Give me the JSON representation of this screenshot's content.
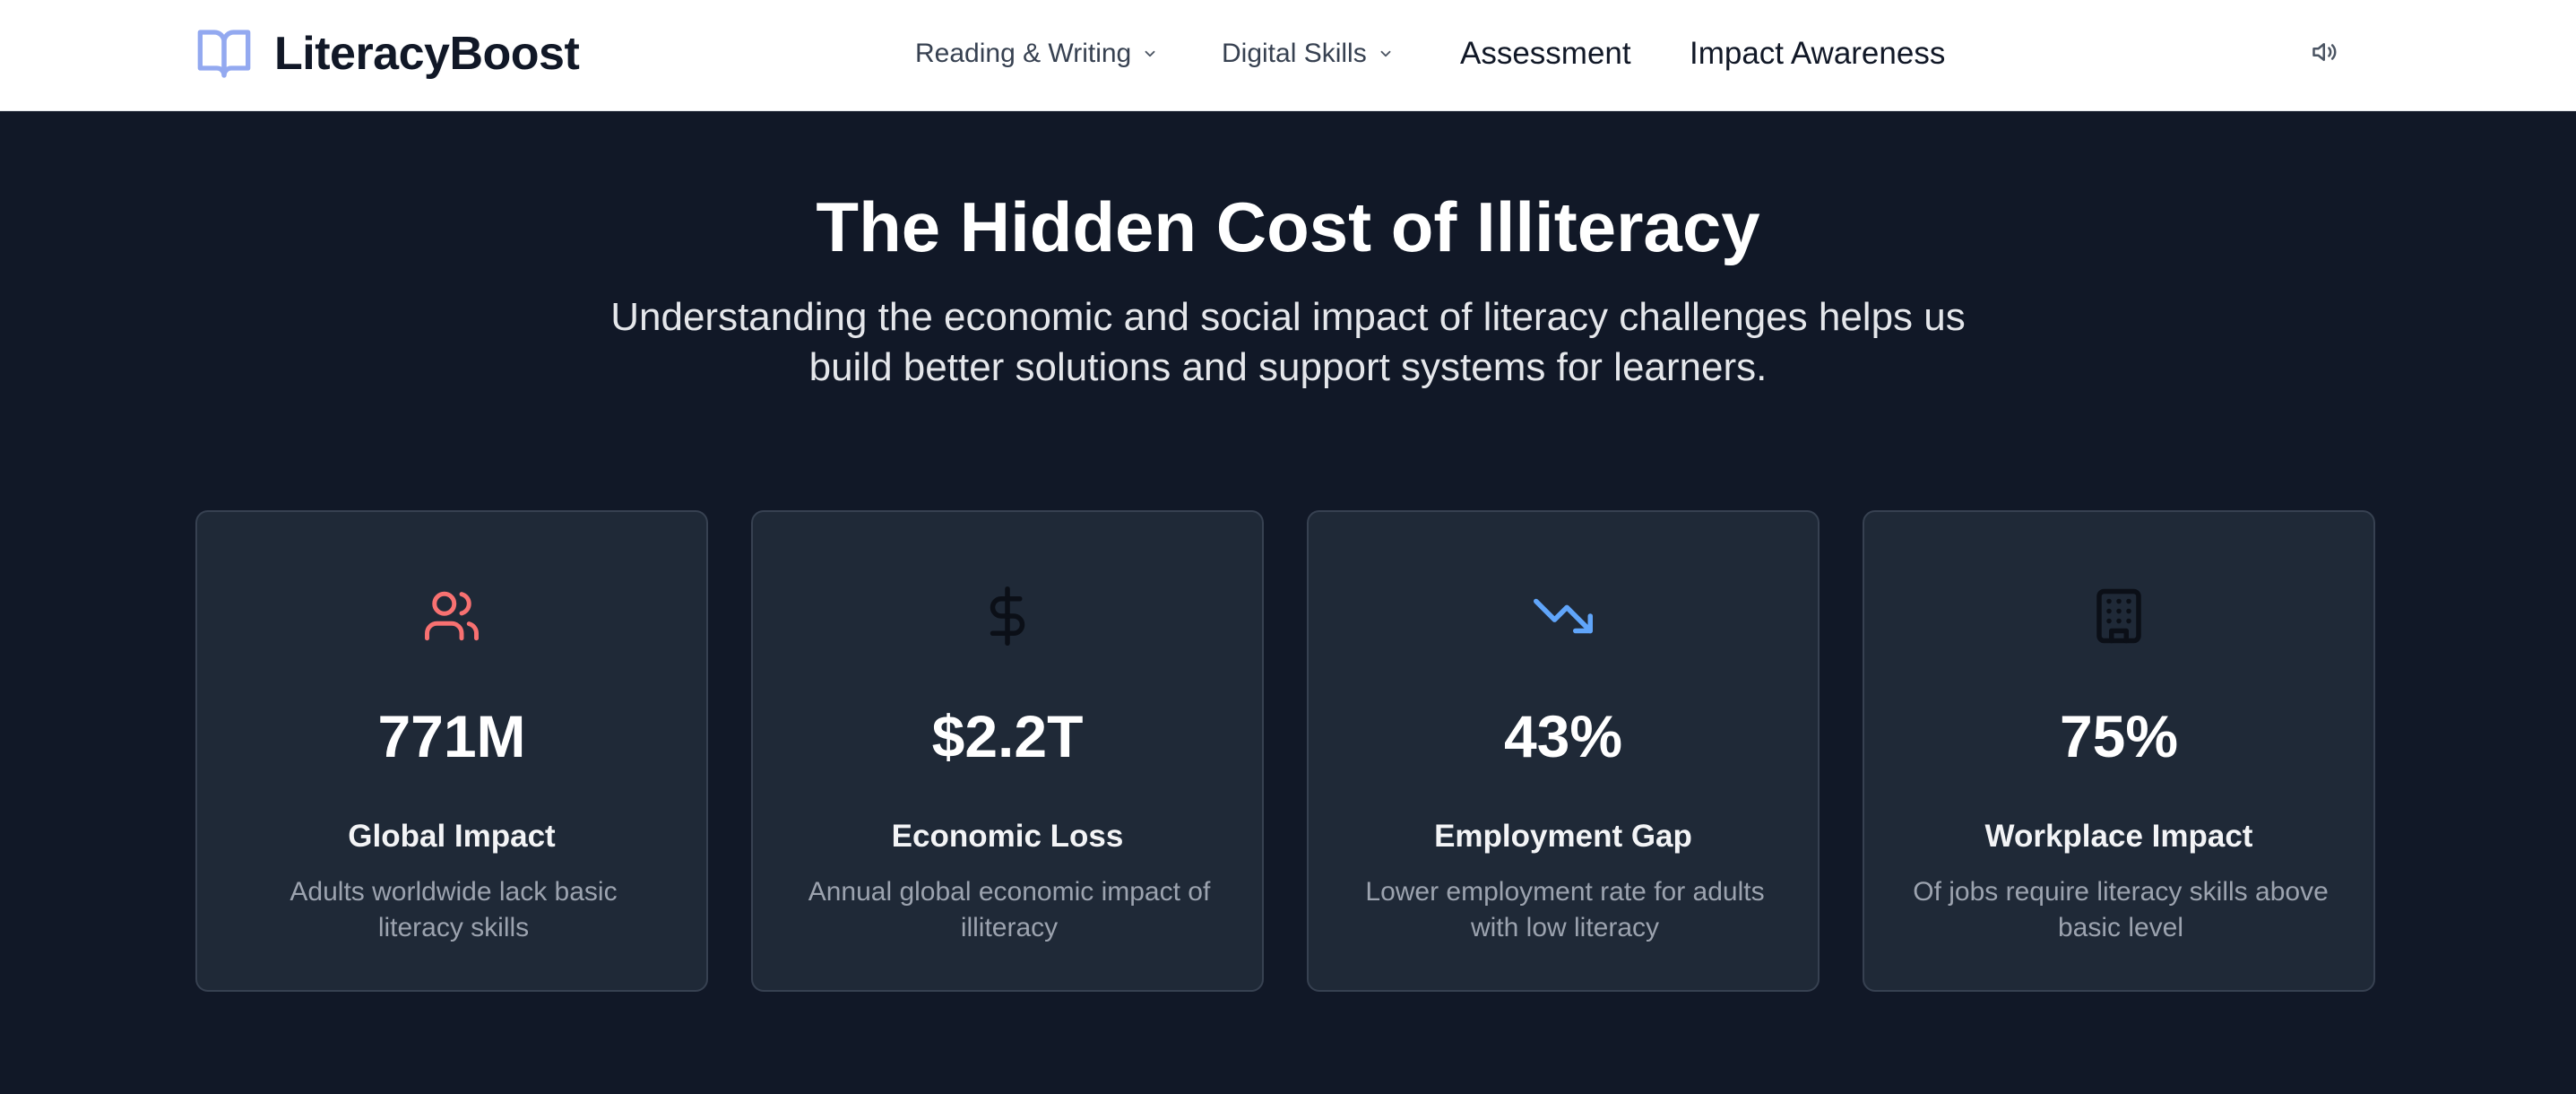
{
  "brand": {
    "name": "LiteracyBoost",
    "icon": "book-open-icon",
    "color": "#93a9f0"
  },
  "nav": {
    "items": [
      {
        "label": "Reading & Writing",
        "has_dropdown": true
      },
      {
        "label": "Digital Skills",
        "has_dropdown": true
      },
      {
        "label": "Assessment",
        "has_dropdown": false
      },
      {
        "label": "Impact Awareness",
        "has_dropdown": false
      }
    ],
    "audio_icon": "speaker-icon"
  },
  "hero": {
    "title": "The Hidden Cost of Illiteracy",
    "subtitle_line1": "Understanding the economic and social impact of literacy challenges helps us",
    "subtitle_line2": "build better solutions and support systems for learners."
  },
  "stats": [
    {
      "icon": "users-icon",
      "icon_color": "#f87171",
      "value": "771M",
      "title": "Global Impact",
      "desc_line1": "Adults worldwide lack basic",
      "desc_line2": "literacy skills"
    },
    {
      "icon": "dollar-sign-icon",
      "icon_color": "#0b0f17",
      "value": "$2.2T",
      "title": "Economic Loss",
      "desc_line1": "Annual global economic impact of",
      "desc_line2": "illiteracy"
    },
    {
      "icon": "trending-down-icon",
      "icon_color": "#60a5fa",
      "value": "43%",
      "title": "Employment Gap",
      "desc_line1": "Lower employment rate for adults",
      "desc_line2": "with low literacy"
    },
    {
      "icon": "building-icon",
      "icon_color": "#0b0f17",
      "value": "75%",
      "title": "Workplace Impact",
      "desc_line1": "Of jobs require literacy skills above",
      "desc_line2": "basic level"
    }
  ],
  "colors": {
    "page_bg": "#111827",
    "card_bg": "#1f2937",
    "card_border": "#374151",
    "navbar_bg": "#ffffff"
  }
}
